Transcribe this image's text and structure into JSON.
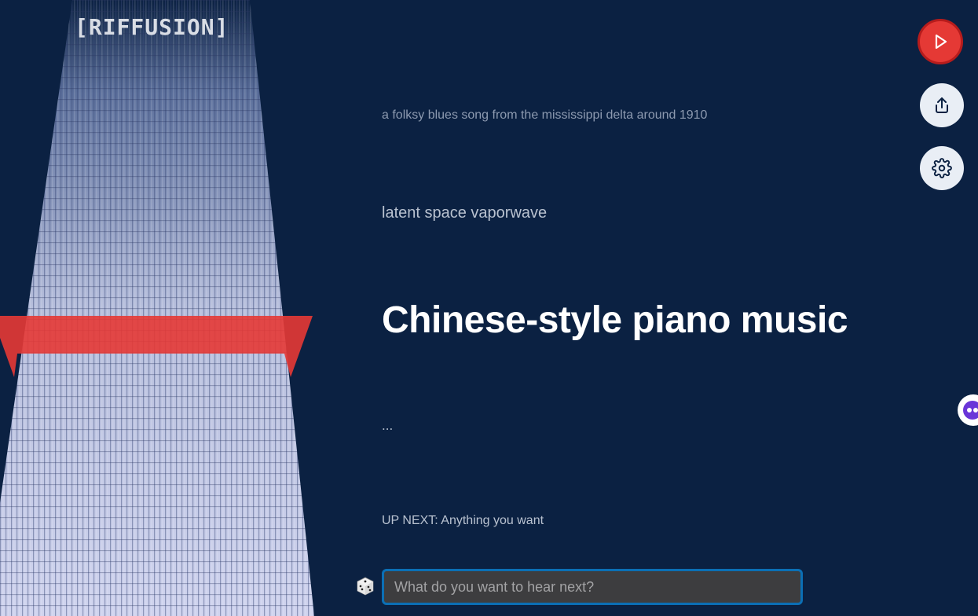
{
  "app": {
    "logo": "[RIFFUSION]"
  },
  "prompts": {
    "previous_2": "a folksy blues song from the mississippi delta around 1910",
    "previous_1": "latent space vaporwave",
    "current": "Chinese-style piano music",
    "next_pending": "...",
    "up_next": "UP NEXT: Anything you want"
  },
  "input": {
    "placeholder": "What do you want to hear next?",
    "value": ""
  },
  "actions": {
    "play_icon": "play-icon",
    "share_icon": "share-icon",
    "settings_icon": "gear-icon",
    "dice_icon": "dice-icon"
  },
  "colors": {
    "background": "#0b2142",
    "play": "#e53935",
    "input_border": "#0b6fb5",
    "playhead": "#e53935"
  }
}
